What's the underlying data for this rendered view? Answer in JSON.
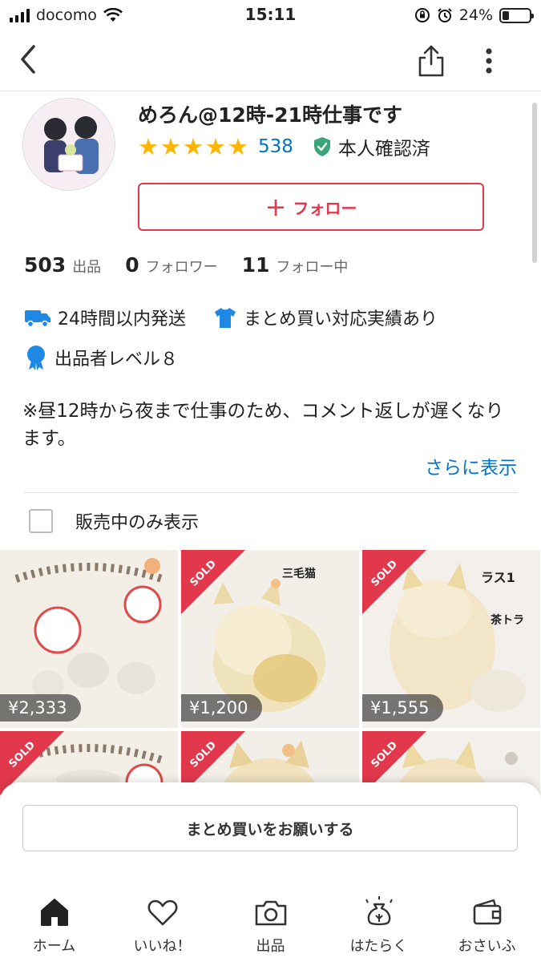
{
  "status_bar": {
    "carrier": "docomo",
    "time": "15:11",
    "battery_percent": "24%",
    "battery_level": 0.24
  },
  "profile": {
    "name": "めろん@12時-21時仕事です",
    "rating_stars": 5,
    "rating_count": "538",
    "verified_label": "本人確認済",
    "follow_label": "フォロー"
  },
  "stats": [
    {
      "value": "503",
      "label": "出品"
    },
    {
      "value": "0",
      "label": "フォロワー"
    },
    {
      "value": "11",
      "label": "フォロー中"
    }
  ],
  "features": {
    "shipping": "24時間以内発送",
    "bulk_purchase": "まとめ買い対応実績あり",
    "seller_level": "出品者レベル８"
  },
  "bio": {
    "text": "※昼12時から夜まで仕事のため、コメント返しが遅くなります。",
    "more_link": "さらに表示"
  },
  "filter": {
    "label": "販売中のみ表示",
    "checked": false
  },
  "products": [
    {
      "price": "¥2,333",
      "sold": false,
      "badge": ""
    },
    {
      "price": "¥1,200",
      "sold": true,
      "badge": "SOLD"
    },
    {
      "price": "¥1,555",
      "sold": true,
      "badge": "SOLD"
    },
    {
      "price": "",
      "sold": true,
      "badge": "SOLD"
    },
    {
      "price": "",
      "sold": true,
      "badge": "SOLD"
    },
    {
      "price": "",
      "sold": true,
      "badge": "SOLD"
    }
  ],
  "bottom_sheet": {
    "bulk_button": "まとめ買いをお願いする"
  },
  "tabs": [
    {
      "label": "ホーム",
      "icon": "home-icon",
      "active": true
    },
    {
      "label": "いいね！",
      "icon": "heart-icon",
      "active": false
    },
    {
      "label": "出品",
      "icon": "camera-icon",
      "active": false
    },
    {
      "label": "はたらく",
      "icon": "money-bag-icon",
      "active": false
    },
    {
      "label": "おさいふ",
      "icon": "wallet-icon",
      "active": false
    }
  ],
  "colors": {
    "accent_red": "#e1384c",
    "link_blue": "#0073cc",
    "star_yellow": "#ffb400",
    "verified_green": "#3aa57a",
    "feature_blue": "#1e88e5"
  }
}
